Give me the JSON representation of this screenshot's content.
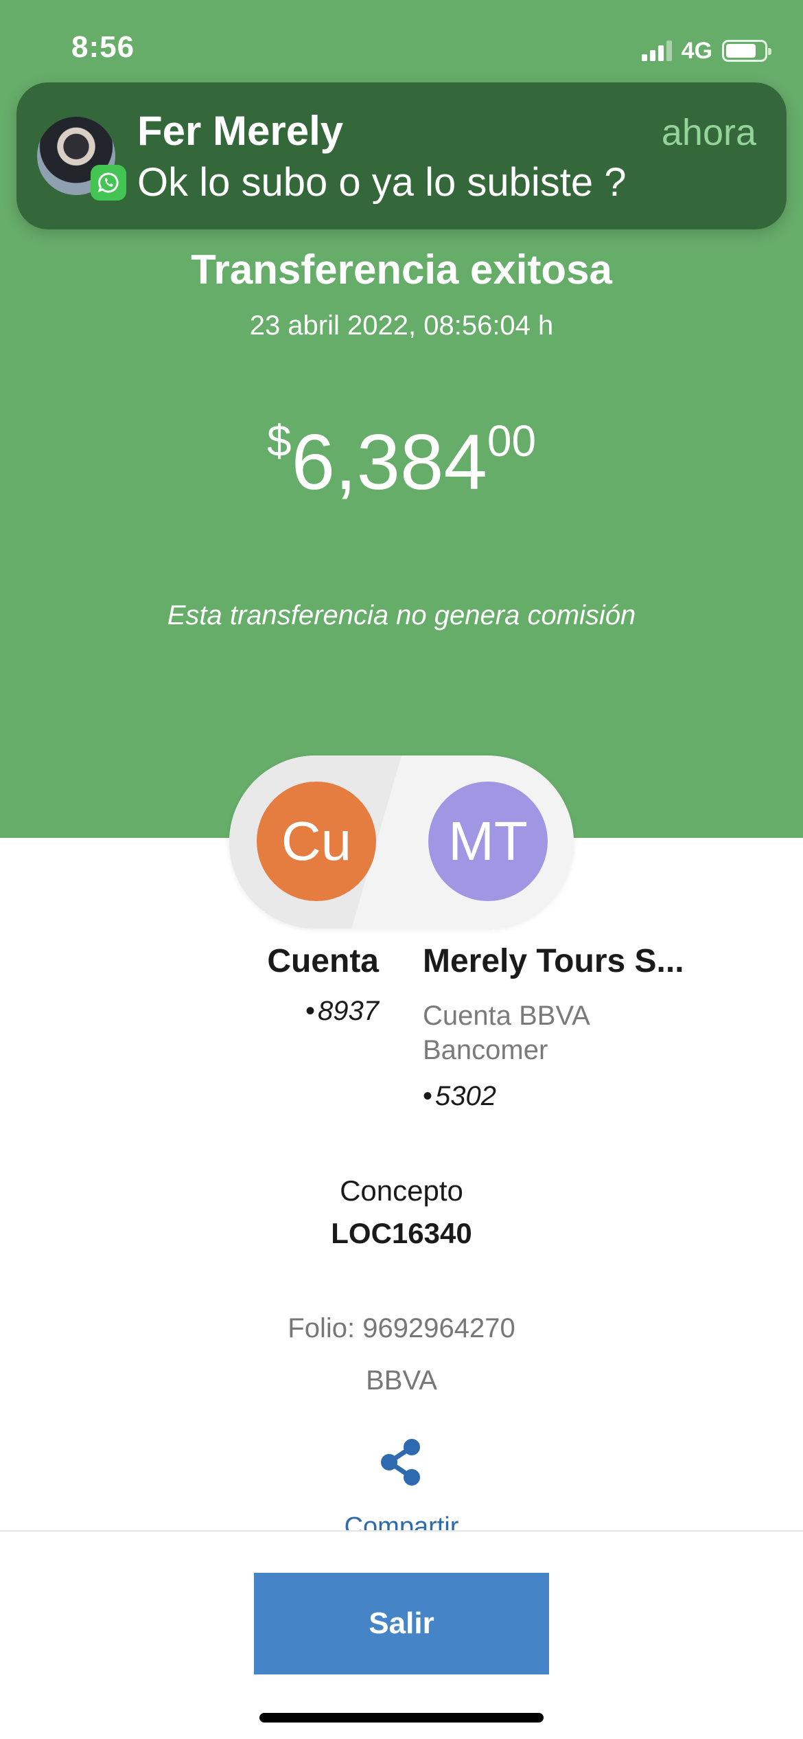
{
  "status_bar": {
    "time": "8:56",
    "network": "4G"
  },
  "notification": {
    "sender": "Fer Merely",
    "message": "Ok lo subo o ya lo subiste ?",
    "time": "ahora",
    "app_icon": "whatsapp-icon"
  },
  "transfer": {
    "title": "Transferencia exitosa",
    "datetime": "23 abril 2022, 08:56:04 h",
    "amount": {
      "currency": "$",
      "integer": "6,384",
      "cents": "00"
    },
    "commission_note": "Esta transferencia no genera comisión"
  },
  "from": {
    "initials": "Cu",
    "name": "Cuenta",
    "bullet": "•",
    "number": "8937",
    "color": "#e57c40"
  },
  "to": {
    "initials": "MT",
    "name": "Merely Tours S...",
    "bank": "Cuenta BBVA Bancomer",
    "bullet": "•",
    "number": "5302",
    "color": "#a196e4"
  },
  "concept": {
    "label": "Concepto",
    "value": "LOC16340"
  },
  "folio": "Folio: 9692964270",
  "bank": "BBVA",
  "share": {
    "label": "Compartir",
    "icon": "share-icon"
  },
  "exit_button": "Salir",
  "colors": {
    "header_green": "#67ad6a",
    "primary_blue": "#4684c8",
    "link_blue": "#2d6ab0"
  }
}
